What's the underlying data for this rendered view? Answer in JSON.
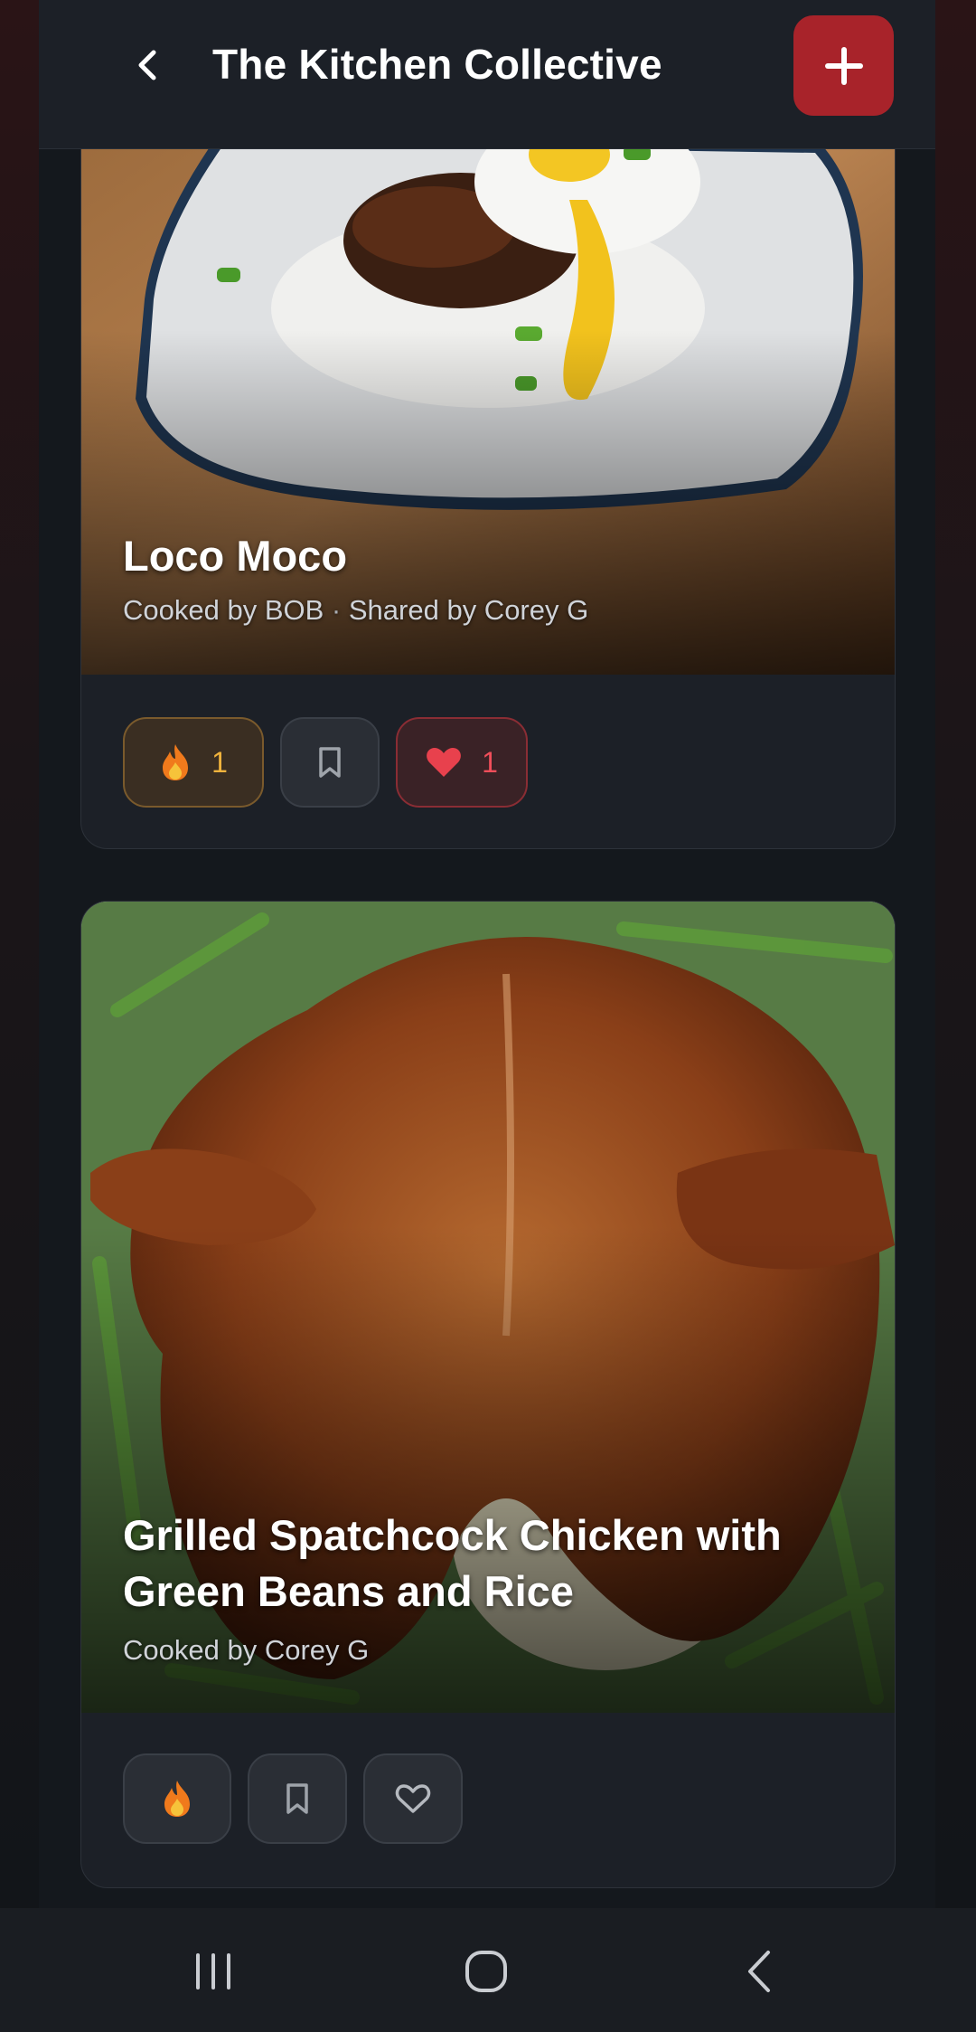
{
  "header": {
    "title": "The Kitchen Collective",
    "back_icon": "chevron-left-icon",
    "add_icon": "plus-icon",
    "accent": "#a8232a"
  },
  "recipes": [
    {
      "title": "Loco Moco",
      "cooked_by": "Cooked by BOB",
      "separator": "·",
      "shared_by": "Shared by Corey G",
      "fire_count": "1",
      "heart_count": "1"
    },
    {
      "title_line1": "Grilled Spatchcock Chicken with",
      "title_line2": "Green Beans and Rice",
      "cooked_by": "Cooked by Corey G"
    }
  ],
  "navbar": {
    "recents_icon": "recent-apps-icon",
    "home_icon": "home-icon",
    "back_icon": "back-icon"
  }
}
